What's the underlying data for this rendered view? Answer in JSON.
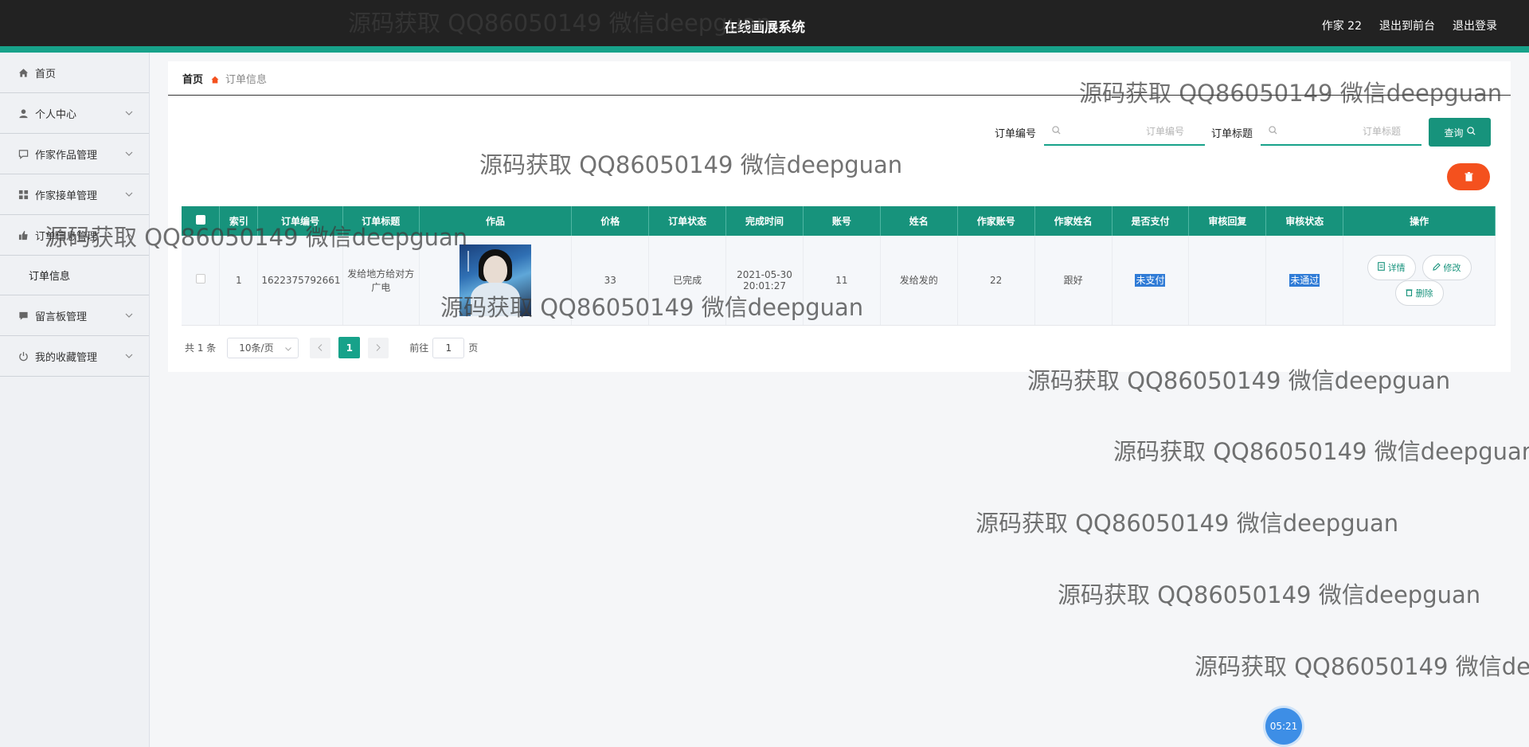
{
  "header": {
    "title": "在线画展系统",
    "user": "作家 22",
    "back_front": "退出到前台",
    "logout": "退出登录"
  },
  "sidebar": {
    "items": [
      {
        "label": "首页"
      },
      {
        "label": "个人中心"
      },
      {
        "label": "作家作品管理"
      },
      {
        "label": "作家接单管理"
      },
      {
        "label": "订单信息管理"
      },
      {
        "label": "订单信息"
      },
      {
        "label": "留言板管理"
      },
      {
        "label": "我的收藏管理"
      }
    ]
  },
  "breadcrumb": {
    "home": "首页",
    "current": "订单信息"
  },
  "search": {
    "order_no_label": "订单编号",
    "order_no_placeholder": "订单编号",
    "order_title_label": "订单标题",
    "order_title_placeholder": "订单标题",
    "query_label": "查询"
  },
  "table": {
    "columns": [
      "",
      "索引",
      "订单编号",
      "订单标题",
      "作品",
      "价格",
      "订单状态",
      "完成时间",
      "账号",
      "姓名",
      "作家账号",
      "作家姓名",
      "是否支付",
      "审核回复",
      "审核状态",
      "操作"
    ],
    "rows": [
      {
        "index": "1",
        "order_no": "1622375792661",
        "order_title": "发给地方给对方广电",
        "price": "33",
        "status": "已完成",
        "finish_time": "2021-05-30 20:01:27",
        "account": "11",
        "name": "发给发的",
        "writer_account": "22",
        "writer_name": "跟好",
        "paid": "未支付",
        "review_reply": "",
        "review_status": "未通过"
      }
    ],
    "ops": {
      "detail": "详情",
      "edit": "修改",
      "delete": "删除"
    }
  },
  "pagination": {
    "total": "共 1 条",
    "page_size": "10条/页",
    "current_page": "1",
    "goto_label": "前往",
    "goto_value": "1",
    "page_unit": "页"
  },
  "watermark": "源码获取 QQ86050149 微信deepguan",
  "clock": "05:21",
  "colors": {
    "accent": "#17a28a",
    "header": "#222222",
    "danger": "#f4511e"
  }
}
